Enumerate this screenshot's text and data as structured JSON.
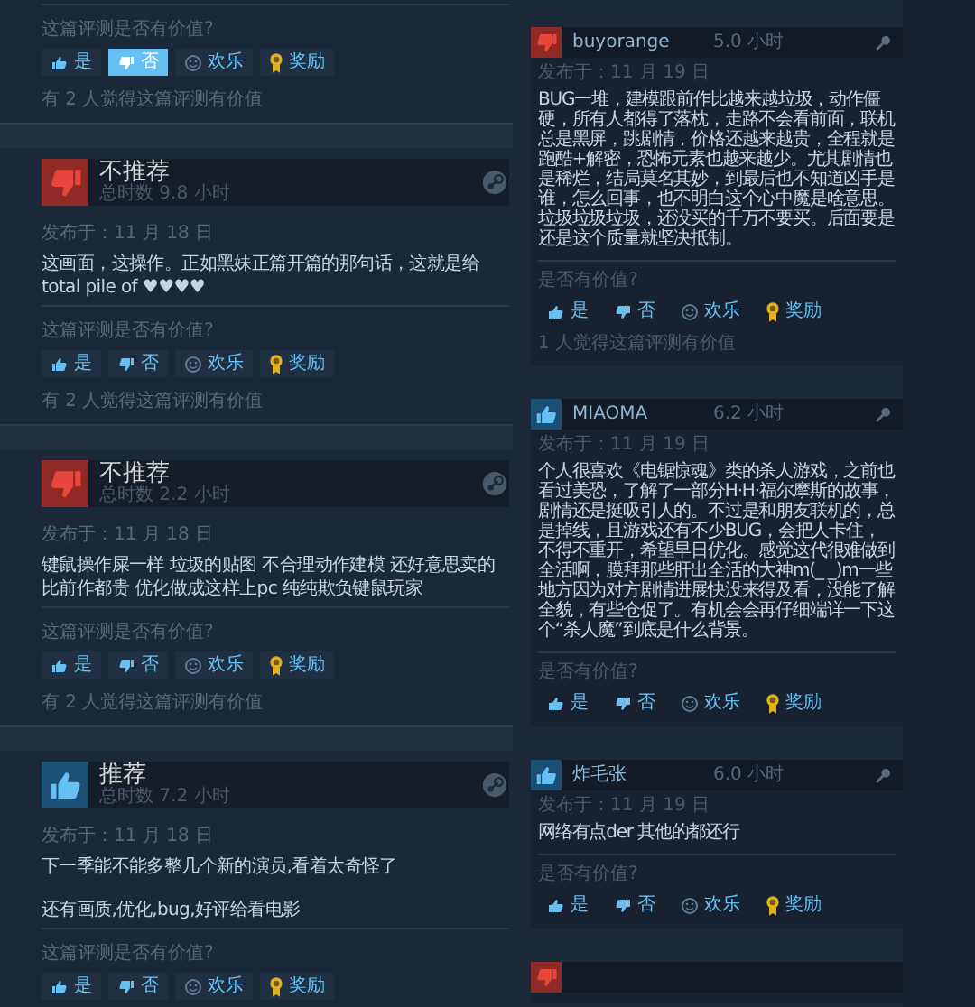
{
  "left_reviews": [
    {
      "helpful_prompt": "这篇评测是否有价值?",
      "votes": [
        {
          "label": "是",
          "kind": "yes",
          "selected": false
        },
        {
          "label": "否",
          "kind": "no",
          "selected": true
        },
        {
          "label": "欢乐",
          "kind": "funny",
          "selected": false
        },
        {
          "label": "奖励",
          "kind": "award",
          "selected": false
        }
      ],
      "helpful_count": "有 2 人觉得这篇评测有价值"
    },
    {
      "recommended": false,
      "verdict": "不推荐",
      "hours": "总时数 9.8 小时",
      "date": "发布于：11 月 18 日",
      "paragraphs": [
        "这画面，这操作。正如黑妹正篇开篇的那句话，这就是给total pile of ♥♥♥♥"
      ],
      "helpful_prompt": "这篇评测是否有价值?",
      "votes": [
        {
          "label": "是",
          "kind": "yes",
          "selected": false
        },
        {
          "label": "否",
          "kind": "no",
          "selected": false
        },
        {
          "label": "欢乐",
          "kind": "funny",
          "selected": false
        },
        {
          "label": "奖励",
          "kind": "award",
          "selected": false
        }
      ],
      "helpful_count": "有 2 人觉得这篇评测有价值"
    },
    {
      "recommended": false,
      "verdict": "不推荐",
      "hours": "总时数 2.2 小时",
      "date": "发布于：11 月 18 日",
      "paragraphs": [
        "键鼠操作屎一样 垃圾的贴图 不合理动作建模 还好意思卖的比前作都贵 优化做成这样上pc 纯纯欺负键鼠玩家"
      ],
      "helpful_prompt": "这篇评测是否有价值?",
      "votes": [
        {
          "label": "是",
          "kind": "yes",
          "selected": false
        },
        {
          "label": "否",
          "kind": "no",
          "selected": false
        },
        {
          "label": "欢乐",
          "kind": "funny",
          "selected": false
        },
        {
          "label": "奖励",
          "kind": "award",
          "selected": false
        }
      ],
      "helpful_count": "有 2 人觉得这篇评测有价值"
    },
    {
      "recommended": true,
      "verdict": "推荐",
      "hours": "总时数 7.2 小时",
      "date": "发布于：11 月 18 日",
      "paragraphs": [
        "下一季能不能多整几个新的演员,看着太奇怪了",
        "还有画质,优化,bug,好评给看电影"
      ],
      "helpful_prompt": "这篇评测是否有价值?",
      "votes": [
        {
          "label": "是",
          "kind": "yes",
          "selected": false
        },
        {
          "label": "否",
          "kind": "no",
          "selected": false
        },
        {
          "label": "欢乐",
          "kind": "funny",
          "selected": false
        },
        {
          "label": "奖励",
          "kind": "award",
          "selected": false
        }
      ]
    }
  ],
  "right_reviews": [
    {
      "recommended": false,
      "author": "buyorange",
      "hours": "5.0 小时",
      "date": "发布于：11 月 19 日",
      "text": "BUG一堆，建模跟前作比越来越垃圾，动作僵硬，所有人都得了落枕，走路不会看前面，联机总是黑屏，跳剧情，价格还越来越贵，全程就是跑酷+解密，恐怖元素也越来越少。尤其剧情也是稀烂，结局莫名其妙，到最后也不知道凶手是谁，怎么回事，也不明白这个心中魔是啥意思。垃圾垃圾垃圾，还没买的千万不要买。后面要是还是这个质量就坚决抵制。",
      "helpful_prompt": "是否有价值?",
      "votes": [
        {
          "label": "是",
          "kind": "yes"
        },
        {
          "label": "否",
          "kind": "no"
        },
        {
          "label": "欢乐",
          "kind": "funny"
        },
        {
          "label": "奖励",
          "kind": "award"
        }
      ],
      "helpful_count": "1 人觉得这篇评测有价值"
    },
    {
      "recommended": true,
      "author": "MIAOMA",
      "hours": "6.2 小时",
      "date": "发布于：11 月 19 日",
      "text": "个人很喜欢《电锯惊魂》类的杀人游戏，之前也看过美恐，了解了一部分H·H·福尔摩斯的故事，剧情还是挺吸引人的。不过是和朋友联机的，总是掉线，且游戏还有不少BUG，会把人卡住，不得不重开，希望早日优化。感觉这代很难做到全活啊，膜拜那些肝出全活的大神m(_ _)m一些地方因为对方剧情进展快没来得及看，没能了解全貌，有些仓促了。有机会会再仔细端详一下这个“杀人魔”到底是什么背景。",
      "helpful_prompt": "是否有价值?",
      "votes": [
        {
          "label": "是",
          "kind": "yes"
        },
        {
          "label": "否",
          "kind": "no"
        },
        {
          "label": "欢乐",
          "kind": "funny"
        },
        {
          "label": "奖励",
          "kind": "award"
        }
      ]
    },
    {
      "recommended": true,
      "author": "炸毛张",
      "hours": "6.0 小时",
      "date": "发布于：11 月 19 日",
      "text": "网络有点der 其他的都还行",
      "helpful_prompt": "是否有价值?",
      "votes": [
        {
          "label": "是",
          "kind": "yes"
        },
        {
          "label": "否",
          "kind": "no"
        },
        {
          "label": "欢乐",
          "kind": "funny"
        },
        {
          "label": "奖励",
          "kind": "award"
        }
      ]
    },
    {
      "recommended": false
    }
  ]
}
